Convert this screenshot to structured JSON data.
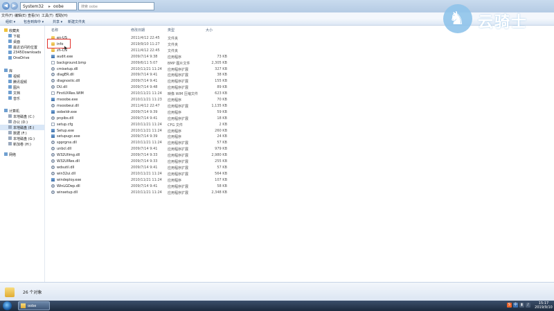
{
  "window": {
    "address": [
      "System32",
      "oobe"
    ],
    "search_placeholder": "搜索 oobe"
  },
  "menu": [
    "文件(F)",
    "编辑(E)",
    "查看(V)",
    "工具(T)",
    "帮助(H)"
  ],
  "toolbar": [
    "组织 ▾",
    "包含到库中 ▾",
    "共享 ▾",
    "新建文件夹"
  ],
  "nav": [
    {
      "label": "收藏夹",
      "icon": "star-icon"
    },
    {
      "label": "下载",
      "icon": "download-folder-icon"
    },
    {
      "label": "桌面",
      "icon": "desktop-icon"
    },
    {
      "label": "最近访问的位置",
      "icon": "recent-places-icon"
    },
    {
      "label": "2345Downloads",
      "icon": "folder-icon"
    },
    {
      "label": "OneDrive",
      "icon": "cloud-icon"
    },
    {
      "label": "库",
      "icon": "library-icon"
    },
    {
      "label": "视频",
      "icon": "video-icon"
    },
    {
      "label": "腾讯视频",
      "icon": "video-icon"
    },
    {
      "label": "图片",
      "icon": "pictures-icon"
    },
    {
      "label": "文档",
      "icon": "documents-icon"
    },
    {
      "label": "音乐",
      "icon": "music-icon"
    },
    {
      "label": "计算机",
      "icon": "computer-icon"
    },
    {
      "label": "本地磁盘 (C:)",
      "icon": "drive-icon"
    },
    {
      "label": "办公 (D:)",
      "icon": "drive-icon"
    },
    {
      "label": "本地磁盘 (E:)",
      "icon": "drive-icon"
    },
    {
      "label": "数据 (F:)",
      "icon": "drive-icon"
    },
    {
      "label": "本地磁盘 (G:)",
      "icon": "drive-icon"
    },
    {
      "label": "新加卷 (H:)",
      "icon": "drive-icon"
    },
    {
      "label": "网络",
      "icon": "network-icon"
    }
  ],
  "columns": [
    "名称",
    "修改日期",
    "类型",
    "大小"
  ],
  "files": [
    {
      "name": "en-US",
      "date": "2011/4/12 22:45",
      "type": "文件夹",
      "size": "",
      "icon": "folder"
    },
    {
      "name": "info",
      "date": "2019/9/10 11:27",
      "type": "文件夹",
      "size": "",
      "icon": "folder"
    },
    {
      "name": "zh-CN",
      "date": "2011/4/12 22:45",
      "type": "文件夹",
      "size": "",
      "icon": "folder"
    },
    {
      "name": "audit.exe",
      "date": "2009/7/14 9:38",
      "type": "应用程序",
      "size": "73 KB",
      "icon": "exe"
    },
    {
      "name": "background.bmp",
      "date": "2009/6/11 5:07",
      "type": "BMP 图片文件",
      "size": "2,305 KB",
      "icon": "file"
    },
    {
      "name": "cmisetup.dll",
      "date": "2010/11/21 11:24",
      "type": "应用程序扩展",
      "size": "327 KB",
      "icon": "gear"
    },
    {
      "name": "diagER.dll",
      "date": "2009/7/14 9:41",
      "type": "应用程序扩展",
      "size": "38 KB",
      "icon": "gear"
    },
    {
      "name": "diagnostic.dll",
      "date": "2009/7/14 9:41",
      "type": "应用程序扩展",
      "size": "155 KB",
      "icon": "gear"
    },
    {
      "name": "DU.dll",
      "date": "2009/7/14 9:48",
      "type": "应用程序扩展",
      "size": "89 KB",
      "icon": "gear"
    },
    {
      "name": "FirstUXRes.WIM",
      "date": "2010/11/21 11:24",
      "type": "映像 WIM 压缩文件",
      "size": "623 KB",
      "icon": "file"
    },
    {
      "name": "msoobe.exe",
      "date": "2010/11/21 11:23",
      "type": "应用程序",
      "size": "70 KB",
      "icon": "exe"
    },
    {
      "name": "msoobeui.dll",
      "date": "2011/4/12 22:47",
      "type": "应用程序扩展",
      "size": "1,135 KB",
      "icon": "gear"
    },
    {
      "name": "oobeldr.exe",
      "date": "2009/7/14 9:39",
      "type": "应用程序",
      "size": "59 KB",
      "icon": "exe"
    },
    {
      "name": "pnpibs.dll",
      "date": "2009/7/14 9:41",
      "type": "应用程序扩展",
      "size": "18 KB",
      "icon": "gear"
    },
    {
      "name": "setup.cfg",
      "date": "2010/11/21 11:24",
      "type": "CFG 文件",
      "size": "2 KB",
      "icon": "file"
    },
    {
      "name": "Setup.exe",
      "date": "2010/11/21 11:24",
      "type": "应用程序",
      "size": "260 KB",
      "icon": "exe"
    },
    {
      "name": "setupugc.exe",
      "date": "2009/7/14 9:39",
      "type": "应用程序",
      "size": "24 KB",
      "icon": "exe"
    },
    {
      "name": "spprgrss.dll",
      "date": "2010/11/21 11:24",
      "type": "应用程序扩展",
      "size": "57 KB",
      "icon": "gear"
    },
    {
      "name": "unbcl.dll",
      "date": "2009/7/14 9:41",
      "type": "应用程序扩展",
      "size": "979 KB",
      "icon": "gear"
    },
    {
      "name": "W32UIImg.dll",
      "date": "2009/7/14 9:33",
      "type": "应用程序扩展",
      "size": "2,980 KB",
      "icon": "gear"
    },
    {
      "name": "W32UIRes.dll",
      "date": "2009/7/14 9:33",
      "type": "应用程序扩展",
      "size": "255 KB",
      "icon": "gear"
    },
    {
      "name": "wdsutil.dll",
      "date": "2009/7/14 9:41",
      "type": "应用程序扩展",
      "size": "57 KB",
      "icon": "gear"
    },
    {
      "name": "win32ui.dll",
      "date": "2010/11/21 11:24",
      "type": "应用程序扩展",
      "size": "564 KB",
      "icon": "gear"
    },
    {
      "name": "windeploy.exe",
      "date": "2010/11/21 11:24",
      "type": "应用程序",
      "size": "107 KB",
      "icon": "exe"
    },
    {
      "name": "WinLGDep.dll",
      "date": "2009/7/14 9:41",
      "type": "应用程序扩展",
      "size": "58 KB",
      "icon": "gear"
    },
    {
      "name": "winsetup.dll",
      "date": "2010/11/21 11:24",
      "type": "应用程序扩展",
      "size": "2,348 KB",
      "icon": "gear"
    }
  ],
  "status": {
    "item_count": "26 个对象"
  },
  "taskbar": {
    "app_label": "oobe",
    "time": "15:17",
    "date": "2019/9/10"
  },
  "logo": {
    "text": "云骑士"
  },
  "colors": {
    "highlight": "#e0302a",
    "selection": "#d9e7f7"
  }
}
